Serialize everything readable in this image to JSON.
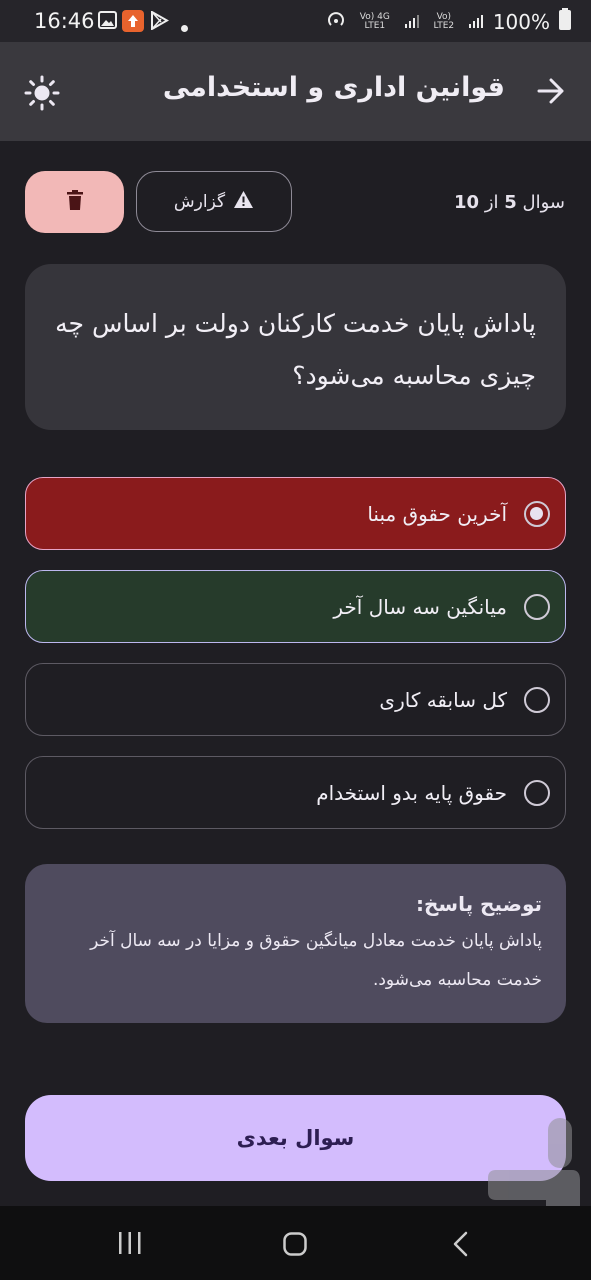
{
  "status_bar": {
    "time": "16:46",
    "network_1": "Vo) 4G LTE1",
    "network_2": "Vo) LTE2",
    "battery": "100%"
  },
  "app_bar": {
    "title": "قوانین اداری و استخدامی",
    "back_icon": "arrow-right-icon",
    "theme_icon": "sun-icon"
  },
  "toolbar": {
    "counter_prefix": "سوال",
    "current": "5",
    "separator": "از",
    "total": "10",
    "report_label": "گزارش",
    "report_icon": "warning-icon",
    "delete_icon": "trash-icon"
  },
  "question": {
    "text": "پاداش پایان خدمت کارکنان دولت بر اساس چه چیزی محاسبه می‌شود؟"
  },
  "options": [
    {
      "label": "آخرین حقوق مبنا",
      "state": "selected-wrong",
      "color": "#8a1b1c"
    },
    {
      "label": "میانگین سه سال آخر",
      "state": "correct",
      "color": "#263b2b"
    },
    {
      "label": "کل سابقه کاری",
      "state": "normal"
    },
    {
      "label": "حقوق پایه بدو استخدام",
      "state": "normal"
    }
  ],
  "explanation": {
    "heading": "توضیح پاسخ:",
    "text": "پاداش پایان خدمت معادل میانگین حقوق و مزایا در سه سال آخر خدمت محاسبه می‌شود."
  },
  "next_button": {
    "label": "سوال بعدی",
    "color": "#d3bcfd"
  },
  "colors": {
    "background": "#1f1e23",
    "app_bar": "#3a393e",
    "delete_button": "#f2b8b7"
  }
}
